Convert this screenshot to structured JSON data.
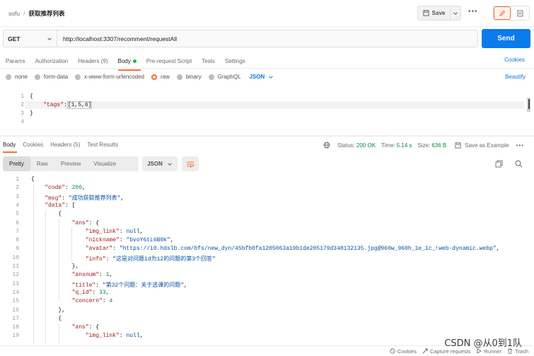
{
  "header": {
    "workspace": "sofu",
    "separator": "/",
    "request_name": "获取推荐列表",
    "save_label": "Save",
    "more_label": "•••"
  },
  "request": {
    "method": "GET",
    "url": "http://localhost:3307/recomment/requestAll",
    "send_label": "Send"
  },
  "request_tabs": {
    "params": "Params",
    "authorization": "Authorization",
    "headers": "Headers (9)",
    "body": "Body",
    "prerequest": "Pre-request Script",
    "tests": "Tests",
    "settings": "Settings",
    "cookies": "Cookies"
  },
  "body_types": {
    "none": "none",
    "form_data": "form-data",
    "urlencoded": "x-www-form-urlencoded",
    "raw": "raw",
    "binary": "binary",
    "graphql": "GraphQL",
    "format": "JSON",
    "beautify": "Beautify"
  },
  "request_body": {
    "line_numbers": [
      "1",
      "2",
      "3",
      "4"
    ],
    "open_brace": "{",
    "key": "\"tags\"",
    "colon": ":",
    "value": "[1,5,6]",
    "close_brace": "}"
  },
  "response_tabs": {
    "body": "Body",
    "cookies": "Cookies",
    "headers": "Headers (5)",
    "test_results": "Test Results"
  },
  "response_stats": {
    "status_label": "Status:",
    "status_value": "200 OK",
    "time_label": "Time:",
    "time_value": "5.14 s",
    "size_label": "Size:",
    "size_value": "636 B",
    "save_example": "Save as Example"
  },
  "response_view": {
    "pretty": "Pretty",
    "raw": "Raw",
    "preview": "Preview",
    "visualize": "Visualize",
    "format": "JSON"
  },
  "response_lines": [
    {
      "n": "1",
      "t": "{"
    },
    {
      "n": "2",
      "t": "    \"code\": 200,"
    },
    {
      "n": "3",
      "t": "    \"msg\": \"成功获取推荐列表\","
    },
    {
      "n": "4",
      "t": "    \"data\": ["
    },
    {
      "n": "5",
      "t": "        {"
    },
    {
      "n": "6",
      "t": "            \"ans\": {"
    },
    {
      "n": "7",
      "t": "                \"img_link\": null,"
    },
    {
      "n": "8",
      "t": "                \"nickname\": \"bvoY6tL6B0k\","
    },
    {
      "n": "9",
      "t": "                \"avatar\": \"https://i0.hdslb.com/bfs/new_dyn/45bfb0fa1205063a19b1de205179d348132135.jpg@960w_960h_1e_1c_!web-dynamic.webp\","
    },
    {
      "n": "10",
      "t": "                \"info\": \"这是对问题id为12的问题的第3个回答\""
    },
    {
      "n": "11",
      "t": "            },"
    },
    {
      "n": "12",
      "t": "            \"ansnum\": 1,"
    },
    {
      "n": "13",
      "t": "            \"title\": \"第32个问题：关于选课的问题\","
    },
    {
      "n": "14",
      "t": "            \"q_id\": 33,"
    },
    {
      "n": "15",
      "t": "            \"concern\": 4"
    },
    {
      "n": "16",
      "t": "        },"
    },
    {
      "n": "17",
      "t": "        {"
    },
    {
      "n": "18",
      "t": "            \"ans\": {"
    },
    {
      "n": "19",
      "t": "                \"img_link\": null,"
    }
  ],
  "status_bar": {
    "cookies": "Cookies",
    "capture": "Capture requests",
    "runner": "Runner",
    "trash": "Trash"
  },
  "watermark": "CSDN @从0到1队",
  "colors": {
    "accent": "#ff6c37",
    "send": "#097bed",
    "status_ok": "#0b8a3e"
  }
}
